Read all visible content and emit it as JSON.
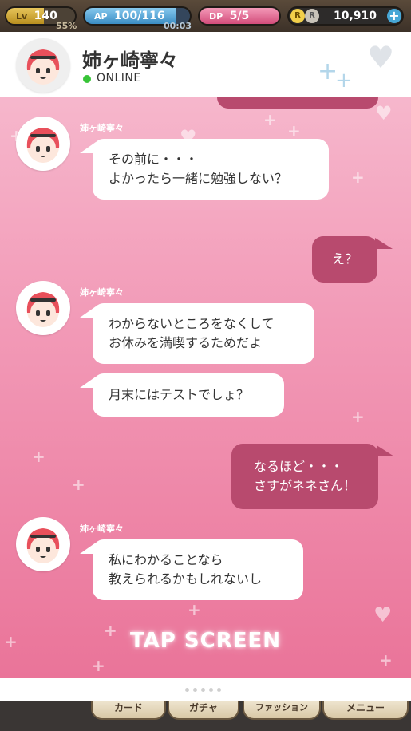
{
  "statusbar": {
    "level": {
      "label": "Lv",
      "value": "140",
      "percent": "55%",
      "progress": 0.55
    },
    "ap": {
      "label": "AP",
      "value": "100/116",
      "timer": "00:03",
      "progress": 0.86
    },
    "dp": {
      "label": "DP",
      "value": "5/5",
      "progress": 1.0
    },
    "rupee": {
      "value": "10,910",
      "coin1": "R",
      "coin2": "R",
      "add": "+"
    }
  },
  "header": {
    "name": "姉ヶ崎寧々",
    "status": "ONLINE",
    "status_color": "#37c437"
  },
  "messages": [
    {
      "sender": "姉ヶ崎寧々",
      "text": "その前に・・・\nよかったら一緒に勉強しない？"
    },
    {
      "text": "え？"
    },
    {
      "sender": "姉ヶ崎寧々",
      "text": "わからないところをなくして\nお休みを満喫するためだよ"
    },
    {
      "text": "月末にはテストでしょ？"
    },
    {
      "text": "なるほど・・・\nさすがネネさん！"
    },
    {
      "sender": "姉ヶ崎寧々",
      "text": "私にわかることなら\n教えられるかもしれないし"
    }
  ],
  "tap_prompt": "TAP SCREEN",
  "bottom_nav": [
    "カード",
    "ガチャ",
    "ファッション",
    "メニュー"
  ],
  "colors": {
    "my_bubble": "#b84a6e",
    "their_bubble": "#ffffff",
    "accent_pink": "#ea7499"
  }
}
